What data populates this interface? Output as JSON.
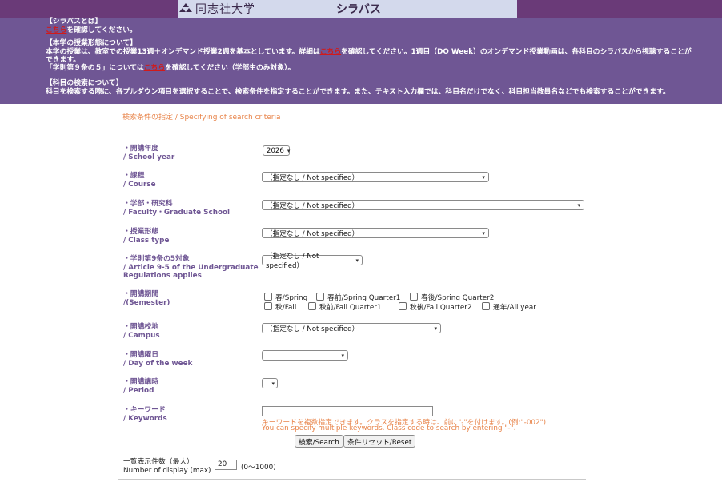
{
  "header": {
    "university_name": "同志社大学",
    "site_title": "シラバス"
  },
  "notice": {
    "syllabus": {
      "heading": "【シラバスとは】",
      "link": "こちら",
      "text": "を確認してください。"
    },
    "class_format": {
      "heading": "【本学の授業形態について】",
      "text1": "本学の授業は、教室での授業13週＋オンデマンド授業2週を基本としています。詳細は",
      "link": "こちら",
      "text2": "を確認してください。1週目（DO Week）のオンデマンド授業動画は、各科目のシラバスから視聴することができます。"
    },
    "article": {
      "text1": "「学則第９条の５」については",
      "link": "こちら",
      "text2": "を確認してください（学部生のみ対象）。"
    },
    "search": {
      "heading": "【科目の検索について】",
      "text": "科目を検索する際に、各プルダウン項目を選択することで、検索条件を指定することができます。また、テキスト入力欄では、科目名だけでなく、科目担当教員名などでも検索することができます。"
    }
  },
  "form": {
    "section_title": "検索条件の指定 / Specifying of search criteria",
    "school_year": {
      "label_jp": "・開講年度",
      "label_en": "/ School year",
      "value": "2026"
    },
    "course": {
      "label_jp": "・課程",
      "label_en": "/ Course",
      "value": "（指定なし / Not specified）"
    },
    "faculty": {
      "label_jp": "・学部・研究科",
      "label_en": "/ Faculty・Graduate School",
      "value": "（指定なし / Not specified）"
    },
    "class_type": {
      "label_jp": "・授業形態",
      "label_en": "/ Class type",
      "value": "（指定なし / Not specified）"
    },
    "article95": {
      "label_jp": "・学則第9条の5対象",
      "label_en1": "/ Article 9-5 of the Undergraduate",
      "label_en2": "Regulations applies",
      "value": "（指定なし / Not specified）"
    },
    "semester": {
      "label_jp": "・開講期間",
      "label_en": "/(Semester)",
      "options": [
        "春/Spring",
        "春前/Spring Quarter1",
        "春後/Spring Quarter2",
        "秋/Fall",
        "秋前/Fall Quarter1",
        "秋後/Fall Quarter2",
        "通年/All year"
      ]
    },
    "campus": {
      "label_jp": "・開講校地",
      "label_en": "/ Campus",
      "value": "（指定なし / Not specified）"
    },
    "day": {
      "label_jp": "・開講曜日",
      "label_en": "/ Day of the week",
      "value": ""
    },
    "period": {
      "label_jp": "・開講講時",
      "label_en": "/ Period",
      "value": ""
    },
    "keywords": {
      "label_jp": "・キーワード",
      "label_en": "/ Keywords",
      "value": "",
      "hint_jp": "キーワードを複数指定できます。クラスを指定する時は、前に\"-\"を付けます。(例:\"-002\")",
      "hint_en": "You can specify multiple keywords. Class code to search by entering \"-\"."
    },
    "search_button": "検索/Search",
    "reset_button": "条件リセット/Reset",
    "display": {
      "label1": "一覧表示件数（最大）:",
      "label2": "Number of display (max)",
      "value": "20",
      "range": "(0〜1000)"
    }
  }
}
